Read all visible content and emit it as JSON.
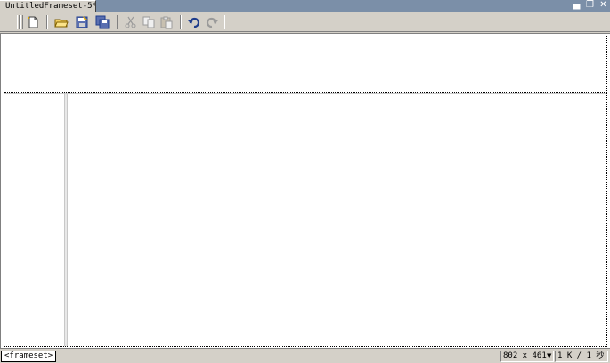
{
  "document": {
    "tab_title": "UntitledFrameset-5*"
  },
  "window_controls": {
    "minimize_glyph": "▄",
    "restore_glyph": "❐",
    "close_glyph": "✕"
  },
  "toolbar": {
    "buttons": [
      {
        "id": "new",
        "icon": "new-file-icon",
        "enabled": true
      },
      {
        "id": "open",
        "icon": "open-folder-icon",
        "enabled": true
      },
      {
        "id": "save",
        "icon": "save-icon",
        "enabled": true
      },
      {
        "id": "save-all",
        "icon": "save-all-icon",
        "enabled": true
      },
      {
        "id": "cut",
        "icon": "cut-icon",
        "enabled": false
      },
      {
        "id": "copy",
        "icon": "copy-icon",
        "enabled": false
      },
      {
        "id": "paste",
        "icon": "paste-icon",
        "enabled": false
      },
      {
        "id": "undo",
        "icon": "undo-icon",
        "enabled": true
      },
      {
        "id": "redo",
        "icon": "redo-icon",
        "enabled": false
      }
    ]
  },
  "colors": {
    "chrome": "#d4d0c8",
    "tab_strip": "#7b8fa8",
    "canvas": "#ffffff",
    "icon_enabled": "#1f3d8c",
    "icon_disabled": "#9a9a9a"
  },
  "statusbar": {
    "tag_selector": "<frameset>",
    "window_size": "802 x 461",
    "download_info": "1 K / 1 秒"
  }
}
